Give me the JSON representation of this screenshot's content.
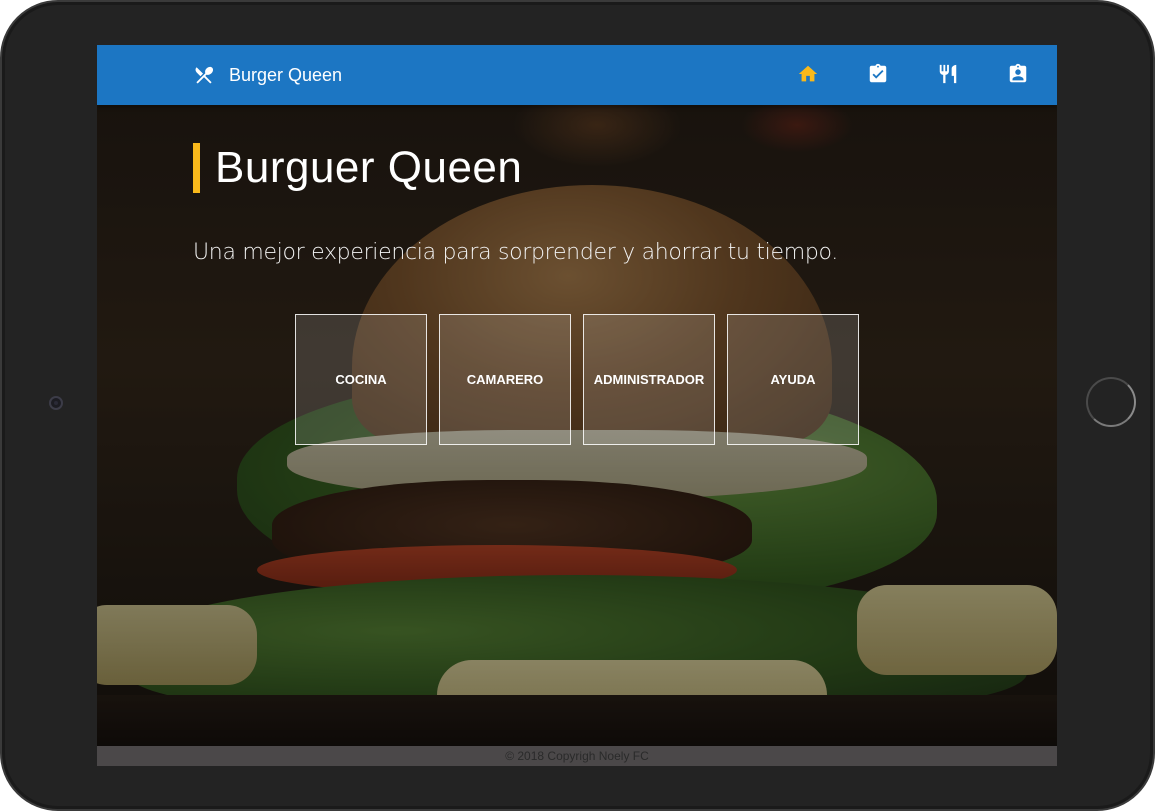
{
  "navbar": {
    "brand": "Burger Queen",
    "accent_color": "#1c76c3",
    "icons": [
      {
        "name": "home-icon",
        "active": true
      },
      {
        "name": "assignment-check-icon",
        "active": false
      },
      {
        "name": "restaurant-icon",
        "active": false
      },
      {
        "name": "contact-badge-icon",
        "active": false
      }
    ]
  },
  "hero": {
    "title": "Burguer Queen",
    "subtitle": "Una mejor experiencia para sorprender y ahorrar tu tiempo.",
    "accent_color": "#f9b91b"
  },
  "tiles": [
    {
      "label": "COCINA"
    },
    {
      "label": "CAMARERO"
    },
    {
      "label": "ADMINISTRADOR"
    },
    {
      "label": "AYUDA"
    }
  ],
  "footer": {
    "text": "© 2018 Copyrigh Noely FC"
  }
}
